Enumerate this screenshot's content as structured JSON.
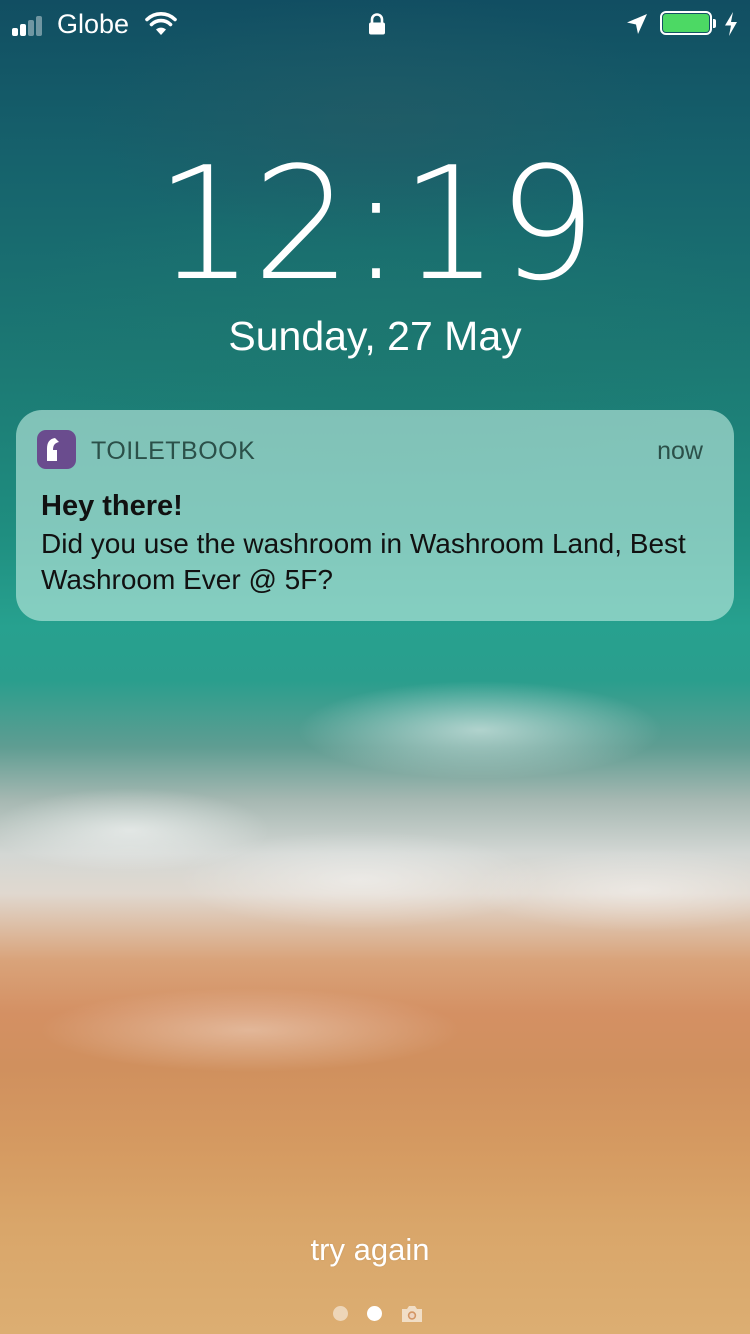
{
  "status_bar": {
    "carrier": "Globe",
    "signal_bars_filled": 2,
    "signal_bars_total": 4,
    "battery_level": 1.0,
    "battery_color": "#4cd964",
    "charging": true,
    "icons": [
      "wifi-icon",
      "lock-icon",
      "location-arrow-icon",
      "battery-icon",
      "charging-bolt-icon"
    ]
  },
  "lock_screen": {
    "time": "12:19",
    "date": "Sunday, 27 May"
  },
  "notification": {
    "app_name": "TOILETBOOK",
    "app_icon_color": "#6a4c8e",
    "timestamp": "now",
    "title": "Hey there!",
    "body": "Did you use the washroom in Washroom Land, Best Washroom Ever @ 5F?"
  },
  "bottom": {
    "hint": "try again",
    "page_count": 2,
    "current_page": 2,
    "camera_icon": "camera-icon"
  }
}
